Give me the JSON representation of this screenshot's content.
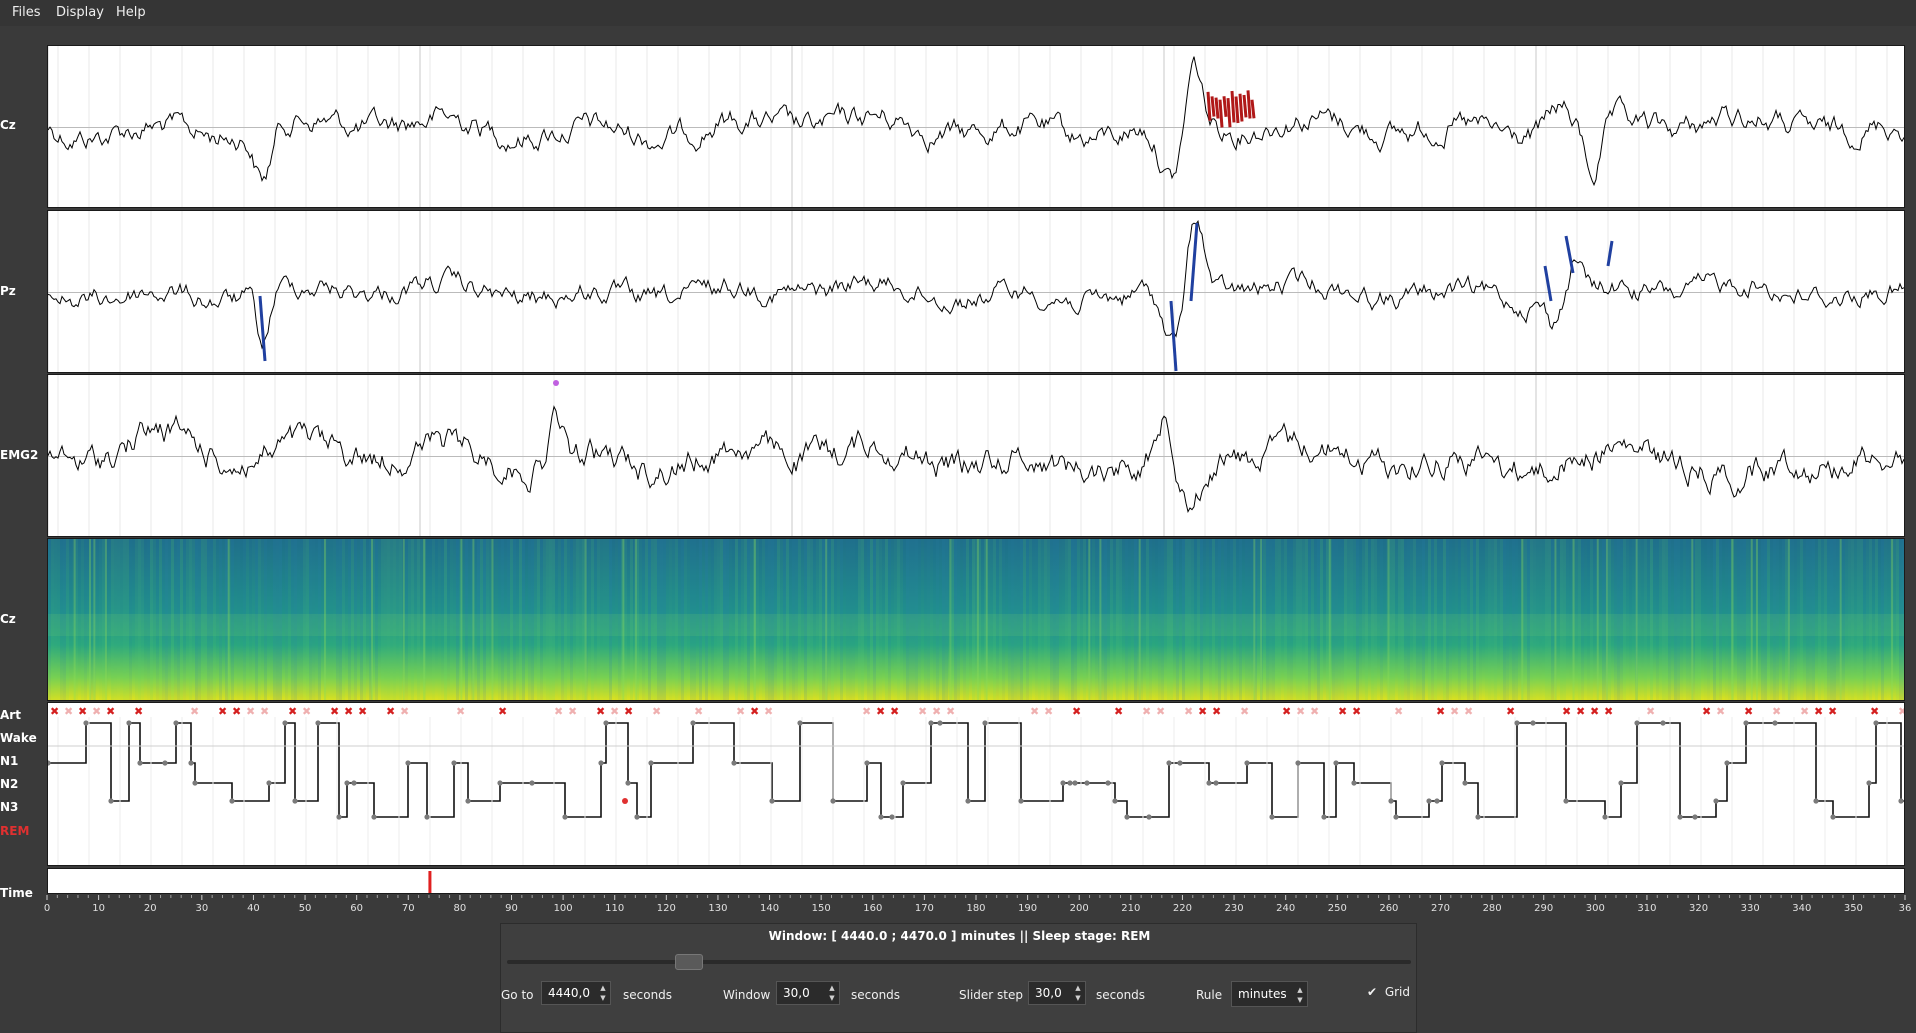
{
  "menu": [
    "Files",
    "Display",
    "Help"
  ],
  "channels": [
    {
      "label": "Cz"
    },
    {
      "label": "Pz"
    },
    {
      "label": "EMG2"
    }
  ],
  "spectrogram": {
    "label": "Cz"
  },
  "hypnogram": {
    "labels": [
      "Art",
      "Wake",
      "N1",
      "N2",
      "N3",
      "REM"
    ],
    "rem_color": "#e03030",
    "artifact_color": "#d42020"
  },
  "timeline": {
    "label": "Time",
    "ticks": [
      "0",
      "10",
      "20",
      "30",
      "40",
      "50",
      "60",
      "70",
      "80",
      "90",
      "100",
      "110",
      "120",
      "130",
      "140",
      "150",
      "160",
      "170",
      "180",
      "190",
      "200",
      "210",
      "220",
      "230",
      "240",
      "250",
      "260",
      "270",
      "280",
      "290",
      "300",
      "310",
      "320",
      "330",
      "340",
      "350",
      "36"
    ],
    "cursor_minutes": 74,
    "cursor_color": "#e02020"
  },
  "controls": {
    "status": "Window: [ 4440.0 ; 4470.0 ] minutes || Sleep stage: REM",
    "slider_position": 0.2,
    "goto_label": "Go to",
    "goto_value": "4440,0",
    "goto_unit": "seconds",
    "window_label": "Window",
    "window_value": "30,0",
    "window_unit": "seconds",
    "step_label": "Slider step",
    "step_value": "30,0",
    "step_unit": "seconds",
    "rule_label": "Rule",
    "rule_value": "minutes",
    "grid_label": "Grid",
    "grid_checked": true
  },
  "colors": {
    "background": "#3a3a3a",
    "eeg_trace": "#000000",
    "highlight_red": "#b01818",
    "highlight_blue": "#2040a0",
    "spectro_low": "#1f6f8b",
    "spectro_mid": "#2aa67f",
    "spectro_high": "#e6e31b"
  }
}
